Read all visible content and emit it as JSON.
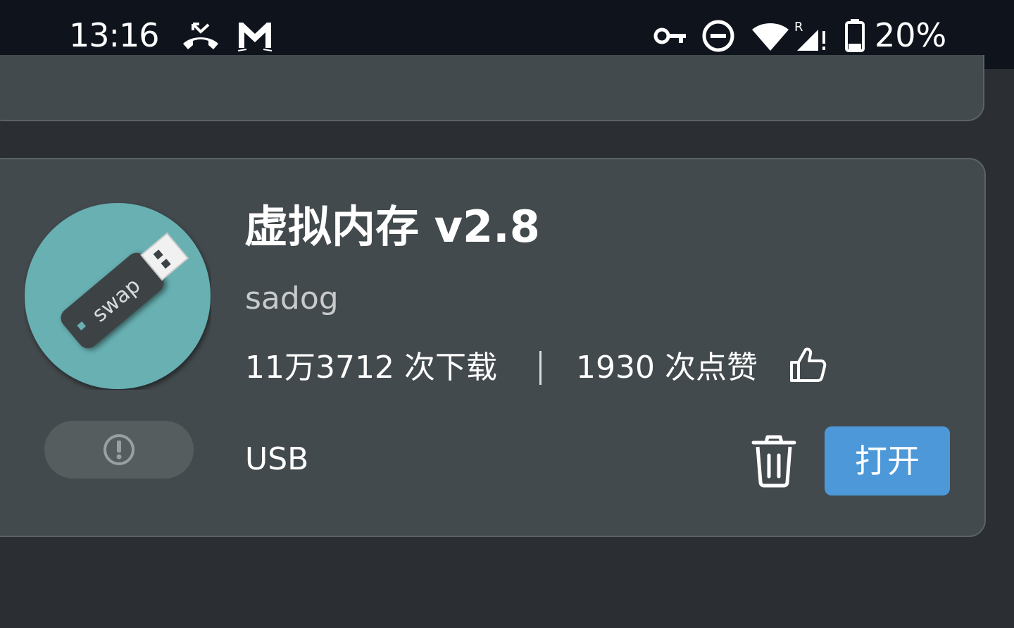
{
  "status_bar": {
    "time": "13:16",
    "battery_percent": "20%",
    "icons": [
      "missed-call-icon",
      "gmail-icon",
      "vpn-key-icon",
      "do-not-disturb-icon",
      "wifi-icon",
      "signal-roaming-icon",
      "battery-icon"
    ]
  },
  "app_card": {
    "title": "虚拟内存 v2.8",
    "author": "sadog",
    "downloads": "11万3712 次下载",
    "likes": "1930 次点赞",
    "tag": "USB",
    "icon_label": "swap",
    "open_button_label": "打开",
    "colors": {
      "icon_circle": "#68b0b2",
      "open_button": "#4d98d8",
      "card_background": "#434a4d",
      "page_background": "#2b2f33"
    }
  }
}
